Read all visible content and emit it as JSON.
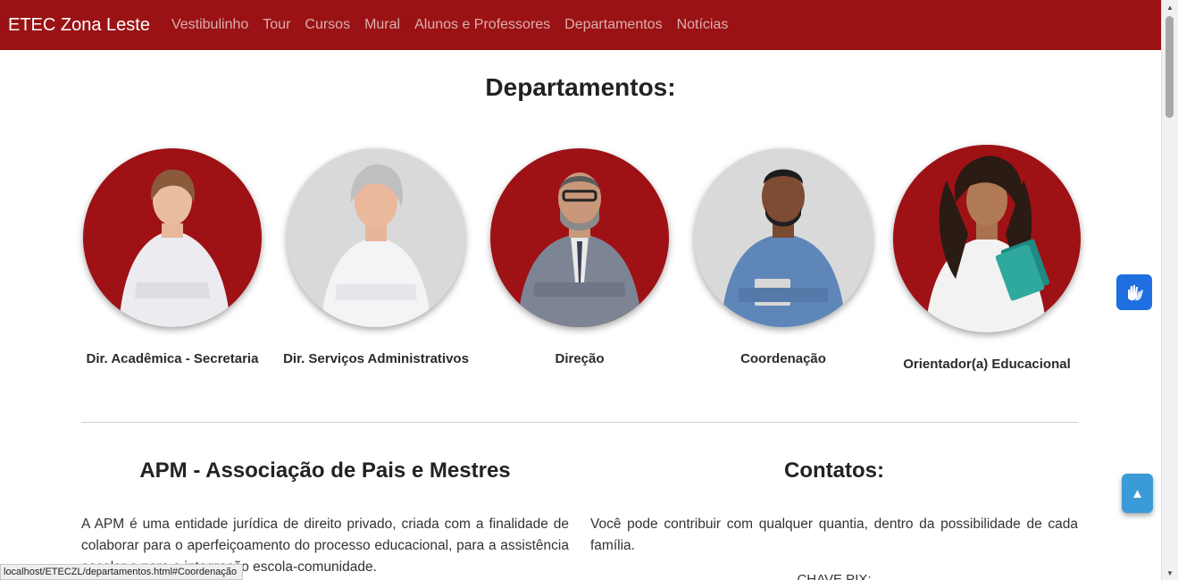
{
  "navbar": {
    "brand": "ETEC Zona Leste",
    "links": [
      "Vestibulinho",
      "Tour",
      "Cursos",
      "Mural",
      "Alunos e Professores",
      "Departamentos",
      "Notícias"
    ]
  },
  "page": {
    "title": "Departamentos:"
  },
  "departments": [
    {
      "label": "Dir. Acadêmica - Secretaria",
      "photo": "woman-young-photo",
      "bg": "#9e1115"
    },
    {
      "label": "Dir. Serviços Administrativos",
      "photo": "woman-senior-photo",
      "bg": "#d9d9d9"
    },
    {
      "label": "Direção",
      "photo": "man-suit-photo",
      "bg": "#9e1115"
    },
    {
      "label": "Coordenação",
      "photo": "man-young-photo",
      "bg": "#d9d9d9"
    },
    {
      "label": "Orientador(a) Educacional",
      "photo": "woman-curly-photo",
      "bg": "#9e1115"
    }
  ],
  "apm": {
    "title": "APM - Associação de Pais e Mestres",
    "text": "A APM é uma entidade jurídica de direito privado, criada com a finalidade de colaborar para o aperfeiçoamento do processo educacional, para a assistência escolar e para a integração escola-comunidade."
  },
  "contacts": {
    "title": "Contatos:",
    "text": "Você pode contribuir com qualquer quantia, dentro da possibilidade de cada família.",
    "pix_label": "CHAVE PIX:"
  },
  "floating": {
    "libras_icon": "sign-language-hands-icon",
    "back_to_top_icon": "triangle-up-icon"
  },
  "status_bar": {
    "url": "localhost/ETECZL/departamentos.html#Coordenação"
  },
  "colors": {
    "navbar": "#9b1214",
    "libras": "#1f6fe0",
    "back_to_top": "#3b9bd9"
  }
}
